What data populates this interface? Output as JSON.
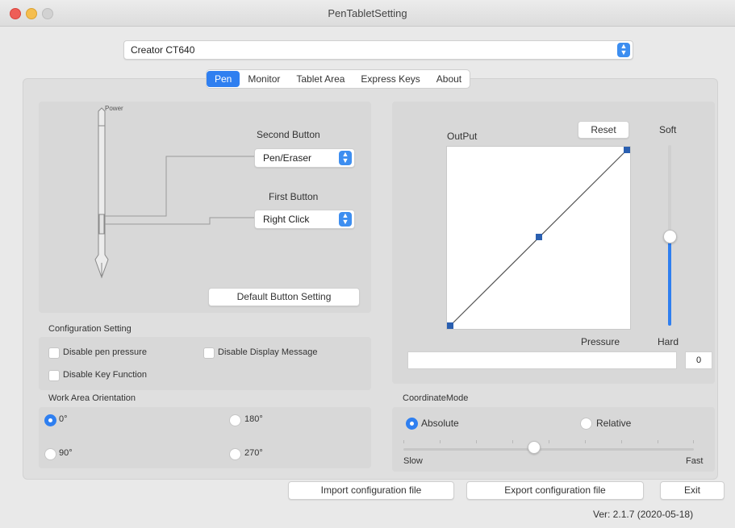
{
  "window": {
    "title": "PenTabletSetting"
  },
  "device_select": {
    "value": "Creator CT640"
  },
  "tabs": [
    {
      "label": "Pen",
      "active": true
    },
    {
      "label": "Monitor",
      "active": false
    },
    {
      "label": "Tablet Area",
      "active": false
    },
    {
      "label": "Express Keys",
      "active": false
    },
    {
      "label": "About",
      "active": false
    }
  ],
  "pen": {
    "power_label": "Power",
    "second_button": {
      "label": "Second Button",
      "value": "Pen/Eraser"
    },
    "first_button": {
      "label": "First Button",
      "value": "Right Click"
    },
    "default_button": "Default  Button Setting"
  },
  "config": {
    "title": "Configuration Setting",
    "disable_pen_pressure": "Disable pen pressure",
    "disable_display_message": "Disable Display Message",
    "disable_key_function": "Disable Key Function"
  },
  "orientation": {
    "title": "Work Area Orientation",
    "options": [
      "0°",
      "180°",
      "90°",
      "270°"
    ],
    "selected": "0°"
  },
  "pressure": {
    "output_label": "OutPut",
    "reset_label": "Reset",
    "pressure_label": "Pressure",
    "soft_label": "Soft",
    "hard_label": "Hard",
    "value": "0",
    "slider_level": 0.5
  },
  "coordinate": {
    "title": "CoordinateMode",
    "absolute": "Absolute",
    "relative": "Relative",
    "selected": "Absolute",
    "slow": "Slow",
    "fast": "Fast",
    "speed_level": 0.45
  },
  "footer": {
    "import": "Import configuration file",
    "export": "Export configuration file",
    "exit": "Exit",
    "version": "Ver: 2.1.7 (2020-05-18)"
  },
  "colors": {
    "accent": "#2f7ff0",
    "curve_point": "#2a5fb0"
  }
}
